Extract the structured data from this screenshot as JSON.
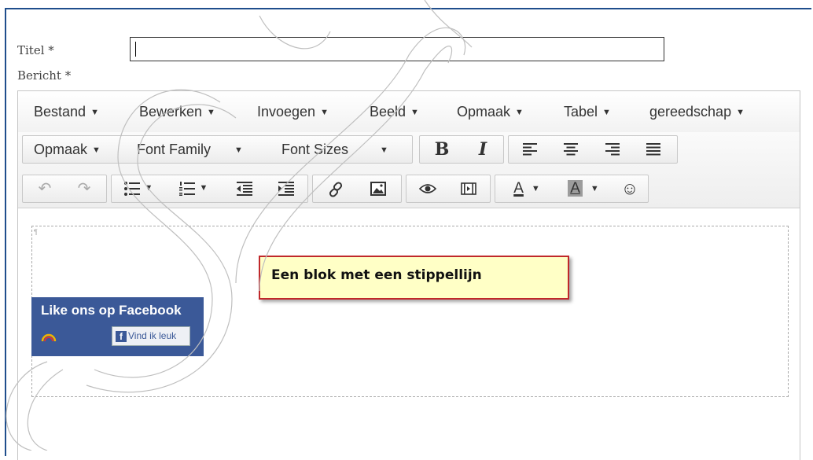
{
  "form": {
    "title_label": "Titel *",
    "message_label": "Bericht *",
    "title_value": ""
  },
  "menubar": {
    "items": [
      "Bestand",
      "Bewerken",
      "Invoegen",
      "Beeld",
      "Opmaak",
      "Tabel",
      "gereedschap"
    ]
  },
  "toolbar": {
    "format_label": "Opmaak",
    "font_family_label": "Font Family",
    "font_sizes_label": "Font Sizes",
    "bold_label": "B",
    "italic_label": "I",
    "text_color_letter": "A",
    "bg_color_letter": "A"
  },
  "content": {
    "facebook_title": "Like ons op Facebook",
    "facebook_button": "Vind ik leuk",
    "facebook_f": "f",
    "block_marker": "¶",
    "callout": "Een blok met een stippellijn"
  },
  "colors": {
    "frame_border": "#1f4e8c",
    "facebook_blue": "#3b5998",
    "callout_bg": "#ffffc6",
    "callout_border": "#c0282a"
  }
}
